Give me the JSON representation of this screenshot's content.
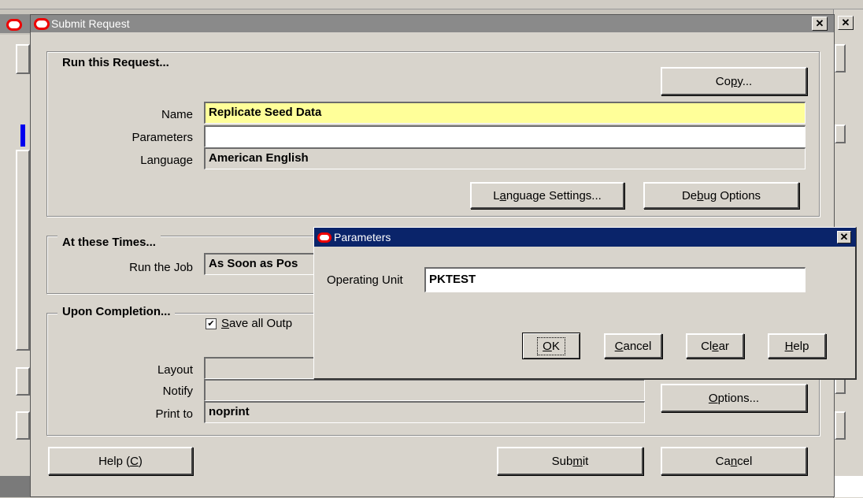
{
  "colors": {
    "dialog_bg": "#d8d4cc",
    "desktop_bg": "#c8c4bc",
    "active_title": "#0a246a",
    "inactive_title": "#8a8a8a",
    "required_field": "#ffff99",
    "input_field": "#ffffff",
    "oracle_red": "#e00000"
  },
  "submit_dialog": {
    "title": "Submit Request",
    "icon": "oracle-icon",
    "run_group": {
      "title": "Run this Request...",
      "copy_button": {
        "pre": "Co",
        "ul": "p",
        "post": "y..."
      },
      "name_label": "Name",
      "name_value": "Replicate Seed Data",
      "parameters_label": "Parameters",
      "parameters_value": "",
      "language_label": "Language",
      "language_value": "American English",
      "language_settings_button": {
        "pre": "L",
        "ul": "a",
        "post": "nguage Settings..."
      },
      "debug_options_button": {
        "pre": "De",
        "ul": "b",
        "post": "ug Options"
      }
    },
    "times_group": {
      "title": "At these Times...",
      "run_job_label": "Run the Job",
      "run_job_value": "As Soon as Pos"
    },
    "completion_group": {
      "title": "Upon Completion...",
      "save_checkbox": {
        "checked": true,
        "pre": "",
        "ul": "S",
        "post": "ave all Outp"
      },
      "layout_label": "Layout",
      "layout_value": "",
      "notify_label": "Notify",
      "notify_value": "",
      "print_to_label": "Print to",
      "print_to_value": "noprint",
      "options_button": {
        "pre": "",
        "ul": "O",
        "post": "ptions..."
      }
    },
    "help_button": {
      "pre": "Help (",
      "ul": "C",
      "post": ")"
    },
    "submit_button": {
      "pre": "Sub",
      "ul": "m",
      "post": "it"
    },
    "cancel_button": {
      "pre": "Ca",
      "ul": "n",
      "post": "cel"
    }
  },
  "parameters_dialog": {
    "title": "Parameters",
    "operating_unit_label": "Operating Unit",
    "operating_unit_value": "PKTEST",
    "ok_button": {
      "pre": "",
      "ul": "O",
      "post": "K"
    },
    "cancel_button": {
      "pre": "",
      "ul": "C",
      "post": "ancel"
    },
    "clear_button": {
      "pre": "Cl",
      "ul": "e",
      "post": "ar"
    },
    "help_button": {
      "pre": "",
      "ul": "H",
      "post": "elp"
    }
  }
}
